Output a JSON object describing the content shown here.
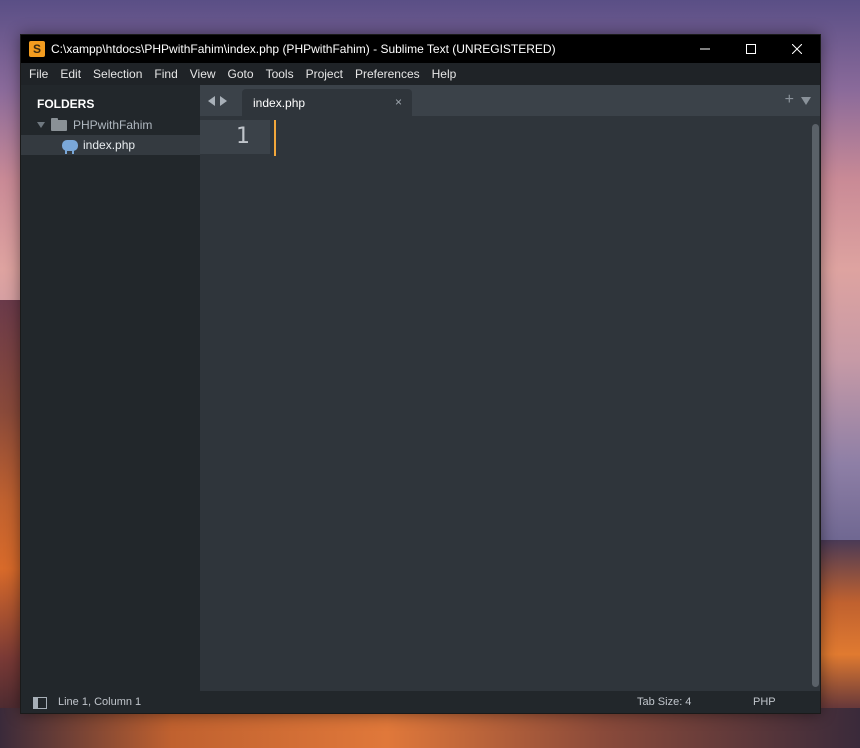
{
  "window": {
    "title": "C:\\xampp\\htdocs\\PHPwithFahim\\index.php (PHPwithFahim) - Sublime Text (UNREGISTERED)",
    "app_icon_letter": "S"
  },
  "menu": {
    "items": [
      "File",
      "Edit",
      "Selection",
      "Find",
      "View",
      "Goto",
      "Tools",
      "Project",
      "Preferences",
      "Help"
    ]
  },
  "sidebar": {
    "heading": "FOLDERS",
    "folder": {
      "name": "PHPwithFahim",
      "expanded": true
    },
    "files": [
      {
        "name": "index.php",
        "selected": true,
        "icon": "php-elephant-icon"
      }
    ]
  },
  "tabs": {
    "items": [
      {
        "label": "index.php",
        "active": true
      }
    ],
    "close_glyph": "×",
    "new_tab_glyph": "+"
  },
  "editor": {
    "line_numbers": [
      "1"
    ],
    "content": ""
  },
  "status": {
    "position": "Line 1, Column 1",
    "tab_size": "Tab Size: 4",
    "syntax": "PHP"
  },
  "colors": {
    "accent_cursor": "#f3a73b",
    "sublime_icon": "#f39c1f"
  }
}
